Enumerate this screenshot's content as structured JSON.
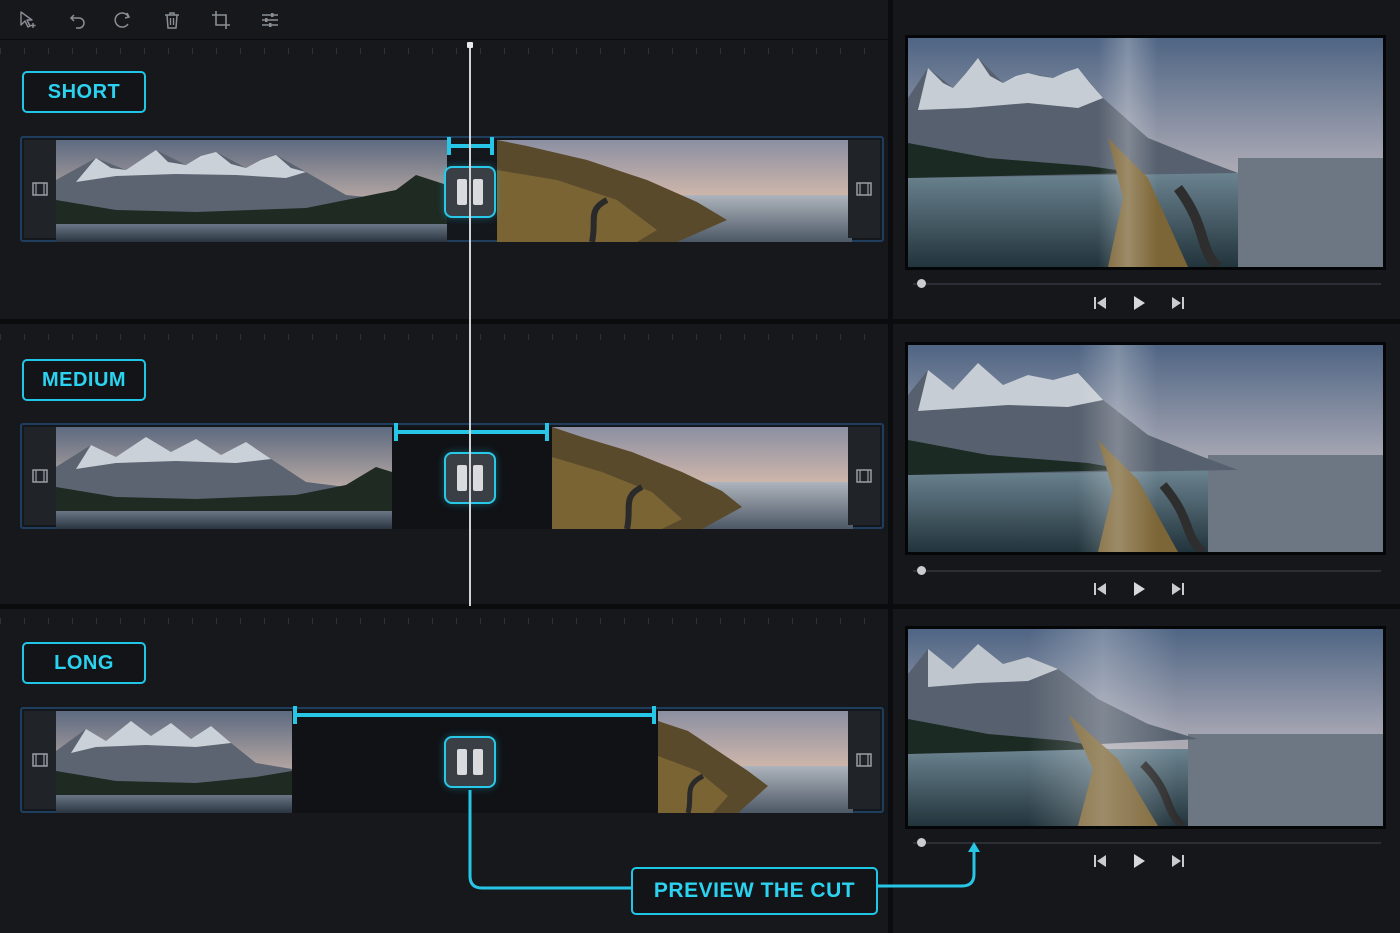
{
  "toolbar": {
    "tools": [
      {
        "name": "select-tool",
        "icon": "cursor-plus-icon"
      },
      {
        "name": "undo",
        "icon": "undo-icon"
      },
      {
        "name": "redo",
        "icon": "redo-icon"
      },
      {
        "name": "delete",
        "icon": "trash-icon"
      },
      {
        "name": "crop",
        "icon": "crop-icon"
      },
      {
        "name": "adjust",
        "icon": "sliders-icon"
      }
    ]
  },
  "rows": [
    {
      "label": "SHORT"
    },
    {
      "label": "MEDIUM"
    },
    {
      "label": "LONG"
    }
  ],
  "callout": {
    "label": "PREVIEW THE CUT"
  },
  "colors": {
    "accent": "#27c6e6",
    "track_border": "#1f3e5e",
    "background": "#16181c"
  }
}
